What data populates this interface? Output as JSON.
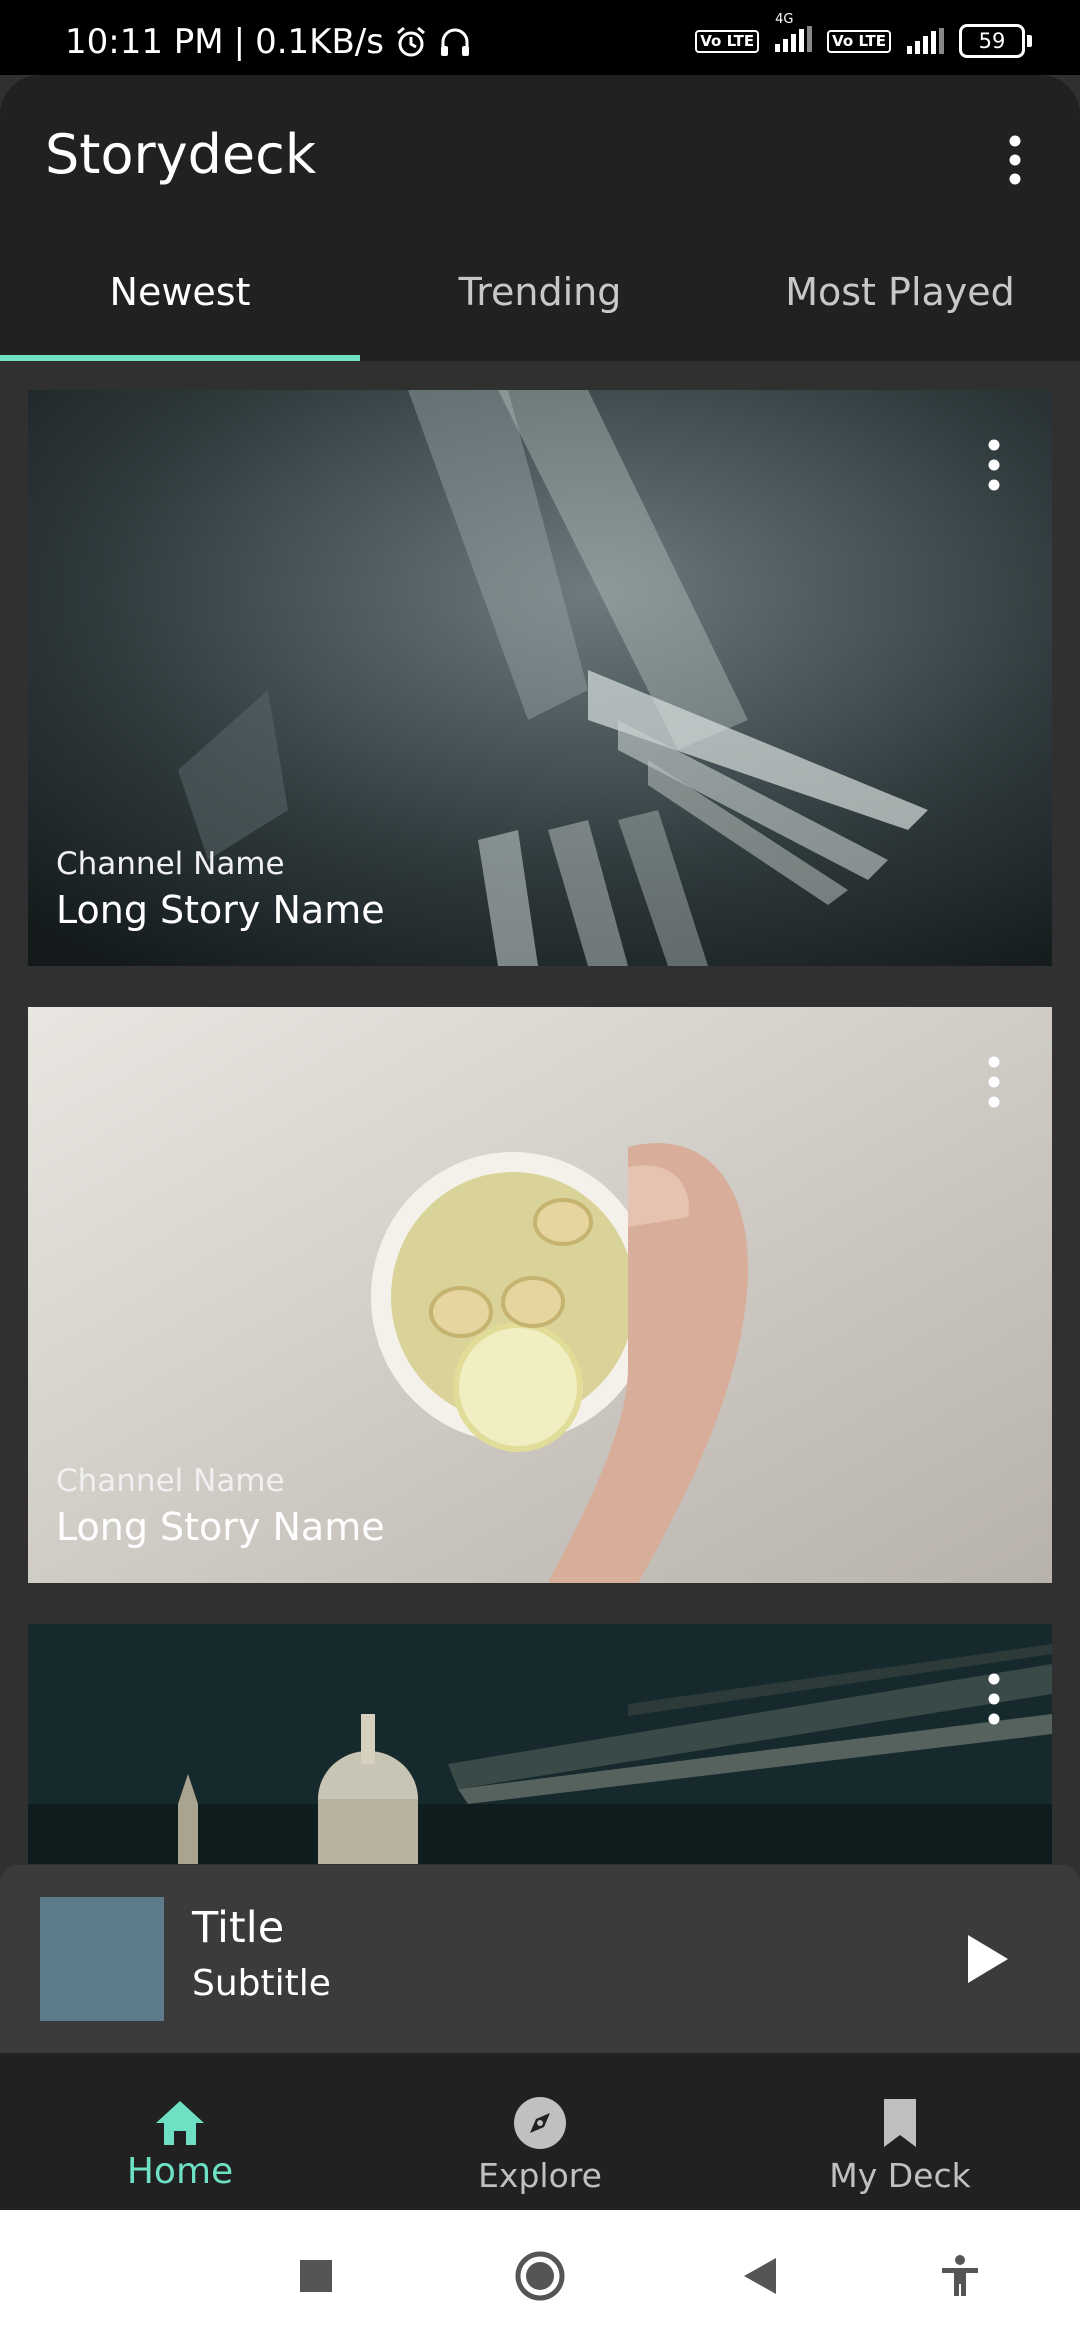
{
  "status_bar": {
    "time": "10:11 PM",
    "speed": "0.1KB/s",
    "separator": "|",
    "volte1": "Vo LTE",
    "network_type": "4G",
    "volte2": "Vo LTE",
    "battery": "59"
  },
  "app": {
    "title": "Storydeck"
  },
  "tabs": [
    {
      "label": "Newest",
      "active": true
    },
    {
      "label": "Trending",
      "active": false
    },
    {
      "label": "Most Played",
      "active": false
    }
  ],
  "cards": [
    {
      "channel": "Channel Name",
      "story": "Long Story Name"
    },
    {
      "channel": "Channel Name",
      "story": "Long Story Name"
    }
  ],
  "player": {
    "title": "Title",
    "subtitle": "Subtitle",
    "art_color": "#5d7b8a"
  },
  "bottom_nav": [
    {
      "label": "Home",
      "icon": "home-icon",
      "active": true
    },
    {
      "label": "Explore",
      "icon": "compass-icon",
      "active": false
    },
    {
      "label": "My Deck",
      "icon": "bookmark-icon",
      "active": false
    }
  ],
  "colors": {
    "accent": "#6ee0c4",
    "app_bar": "#212121",
    "background": "#303030",
    "player": "#3b3b3b"
  }
}
